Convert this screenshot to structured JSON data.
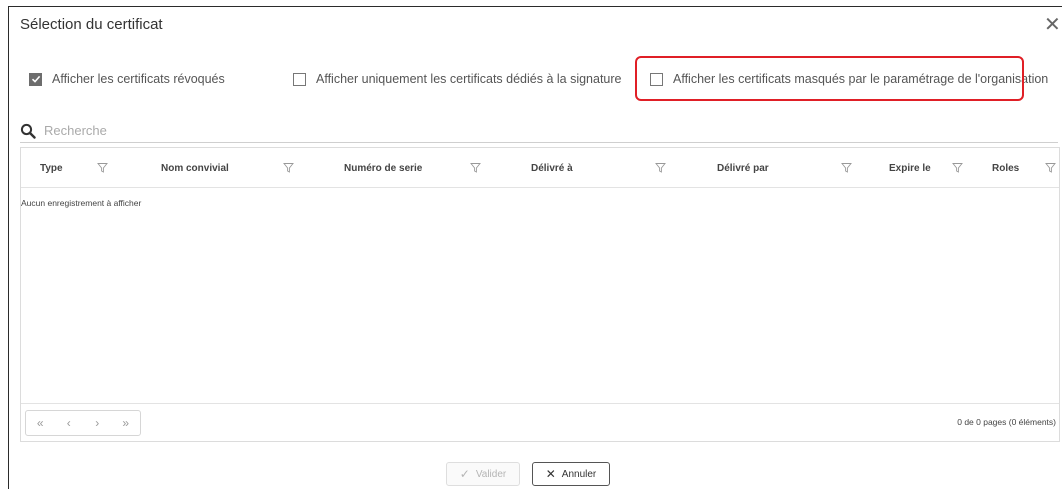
{
  "dialog": {
    "title": "Sélection du certificat",
    "close_symbol": "✕"
  },
  "options": [
    {
      "label": "Afficher les certificats révoqués",
      "checked": true
    },
    {
      "label": "Afficher uniquement les certificats dédiés à la signature",
      "checked": false
    },
    {
      "label": "Afficher les certificats masqués par le paramétrage de l'organisation",
      "checked": false,
      "highlighted": true
    }
  ],
  "search": {
    "placeholder": "Recherche",
    "value": ""
  },
  "grid": {
    "columns": [
      "Type",
      "Nom convivial",
      "Numéro de serie",
      "Délivré à",
      "Délivré par",
      "Expire le",
      "Roles"
    ],
    "rows": [],
    "empty_message": "Aucun enregistrement à afficher"
  },
  "pager": {
    "first": "«",
    "prev": "‹",
    "next": "›",
    "last": "»",
    "info": "0 de 0 pages (0 éléments)"
  },
  "buttons": {
    "validate": {
      "label": "Valider",
      "icon": "✓",
      "enabled": false
    },
    "cancel": {
      "label": "Annuler",
      "icon": "✕",
      "enabled": true
    }
  },
  "colors": {
    "highlight": "#e01f26",
    "checkbox_checked": "#6d6d6d"
  }
}
